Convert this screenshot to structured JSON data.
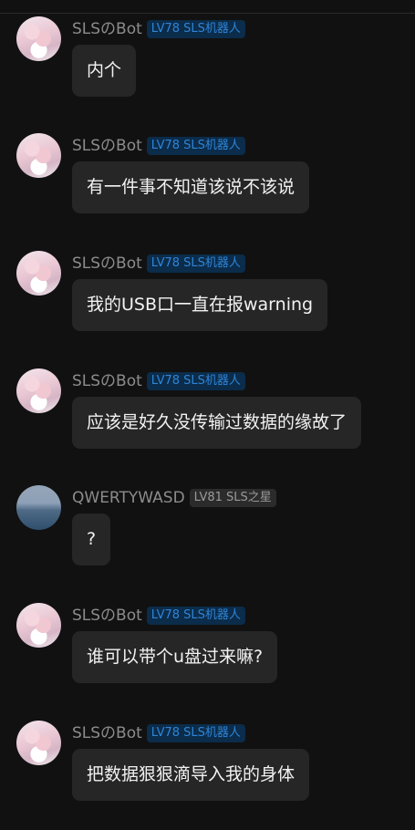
{
  "messages": [
    {
      "name": "SLSのBot",
      "badge": "LV78 SLS机器人",
      "text": "内个",
      "avatar": "anime-girl-avatar"
    },
    {
      "name": "SLSのBot",
      "badge": "LV78 SLS机器人",
      "text": "有一件事不知道该说不该说",
      "avatar": "anime-girl-avatar"
    },
    {
      "name": "SLSのBot",
      "badge": "LV78 SLS机器人",
      "text": "我的USB口一直在报warning",
      "avatar": "anime-girl-avatar"
    },
    {
      "name": "SLSのBot",
      "badge": "LV78 SLS机器人",
      "text": "应该是好久没传输过数据的缘故了",
      "avatar": "anime-girl-avatar"
    },
    {
      "name": "QWERTYWASD",
      "badge": "LV81 SLS之星",
      "text": "?",
      "avatar": "sea-avatar"
    },
    {
      "name": "SLSのBot",
      "badge": "LV78 SLS机器人",
      "text": "谁可以带个u盘过来嘛?",
      "avatar": "anime-girl-avatar"
    },
    {
      "name": "SLSのBot",
      "badge": "LV78 SLS机器人",
      "text": "把数据狠狠滴导入我的身体",
      "avatar": "anime-girl-avatar"
    }
  ],
  "colors": {
    "background": "#111111",
    "bubble": "#262626",
    "badge_blue_bg": "#0b2c4a",
    "badge_blue_text": "#2f84d6",
    "badge_gray_bg": "#2b2b2b",
    "badge_gray_text": "#9a9a9a",
    "name_text": "#8c8c8c"
  }
}
